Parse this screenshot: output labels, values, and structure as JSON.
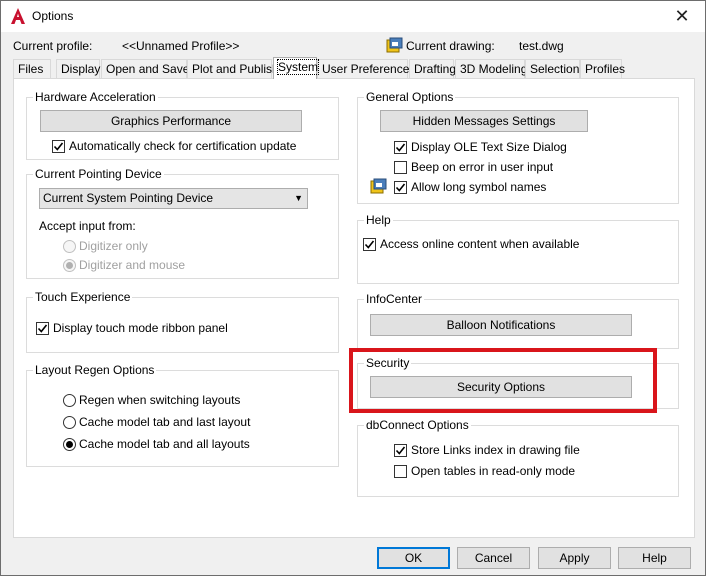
{
  "window": {
    "title": "Options",
    "close_symbol": "✕"
  },
  "profile": {
    "current_profile_label": "Current profile:",
    "current_profile_value": "<<Unnamed Profile>>",
    "current_drawing_label": "Current drawing:",
    "current_drawing_value": "test.dwg"
  },
  "tabs": [
    {
      "label": "Files"
    },
    {
      "label": "Display"
    },
    {
      "label": "Open and Save"
    },
    {
      "label": "Plot and Publish"
    },
    {
      "label": "System"
    },
    {
      "label": "User Preferences"
    },
    {
      "label": "Drafting"
    },
    {
      "label": "3D Modeling"
    },
    {
      "label": "Selection"
    },
    {
      "label": "Profiles"
    }
  ],
  "active_tab": "System",
  "hardware": {
    "title": "Hardware Acceleration",
    "button": "Graphics Performance",
    "auto_check_label": "Automatically check for certification update",
    "auto_check": true
  },
  "pointing": {
    "title": "Current Pointing Device",
    "selected": "Current System Pointing Device",
    "accept_label": "Accept input from:",
    "options": [
      "Digitizer only",
      "Digitizer and mouse"
    ],
    "selected_option": 1
  },
  "touch": {
    "title": "Touch Experience",
    "ribbon_label": "Display touch mode ribbon panel",
    "ribbon": true
  },
  "layout_regen": {
    "title": "Layout Regen Options",
    "options": [
      "Regen when switching layouts",
      "Cache model tab and last layout",
      "Cache model tab and all layouts"
    ],
    "selected_option": 2
  },
  "general": {
    "title": "General Options",
    "button": "Hidden Messages Settings",
    "ole_label": "Display OLE Text Size Dialog",
    "ole": true,
    "beep_label": "Beep on error in user input",
    "beep": false,
    "long_names_label": "Allow long symbol names",
    "long_names": true
  },
  "help": {
    "title": "Help",
    "online_label": "Access online content when available",
    "online": true
  },
  "infocenter": {
    "title": "InfoCenter",
    "button": "Balloon Notifications"
  },
  "security": {
    "title": "Security",
    "button": "Security Options"
  },
  "dbconnect": {
    "title": "dbConnect Options",
    "store_label": "Store Links index in drawing file",
    "store": true,
    "readonly_label": "Open tables in read-only mode",
    "readonly": false
  },
  "footer": {
    "ok": "OK",
    "cancel": "Cancel",
    "apply": "Apply",
    "help": "Help"
  },
  "colors": {
    "highlight": "#d9151b",
    "accent": "#0078d7"
  }
}
